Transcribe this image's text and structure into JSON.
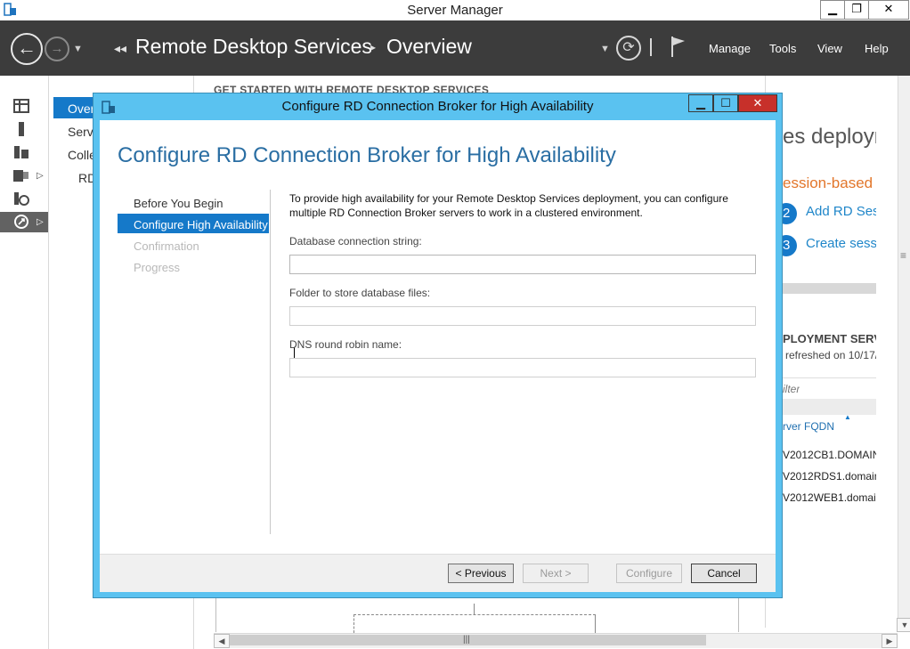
{
  "window": {
    "title": "Server Manager",
    "controls": {
      "minimize": "▁",
      "restore": "❐",
      "close": "✕"
    }
  },
  "header": {
    "breadcrumb": [
      "Remote Desktop Services",
      "Overview"
    ],
    "menu": [
      "Manage",
      "Tools",
      "View",
      "Help"
    ]
  },
  "left_nav": {
    "items": [
      "Overview",
      "Servers",
      "Collections",
      "RD"
    ]
  },
  "background": {
    "heading": "GET STARTED WITH REMOTE DESKTOP SERVICES",
    "right_fragments": {
      "deploy": "es deployn",
      "session": "ession-based",
      "step2_num": "2",
      "step2": "Add RD Ses",
      "step3_num": "3",
      "step3": "Create sess",
      "servers_title": "PLOYMENT SERV",
      "refreshed": "refreshed on 10/17/",
      "filter": "ilter",
      "fqdn_header": "rver FQDN",
      "rows": [
        "V2012CB1.DOMAIN",
        "V2012RDS1.domain",
        "V2012WEB1.domain"
      ]
    }
  },
  "dialog": {
    "title": "Configure RD Connection Broker for High Availability",
    "heading": "Configure RD Connection Broker for High Availability",
    "controls": {
      "minimize": "▁",
      "maximize": "☐",
      "close": "✕"
    },
    "steps": [
      "Before You Begin",
      "Configure High Availability",
      "Confirmation",
      "Progress"
    ],
    "description": "To provide high availability for your Remote Desktop Services deployment, you can configure multiple RD Connection Broker servers to work in a clustered environment.",
    "fields": {
      "db_label": "Database connection string:",
      "db_value": "",
      "folder_label": "Folder to store database files:",
      "folder_value": "",
      "dns_label": "DNS round robin name:",
      "dns_value": ""
    },
    "buttons": {
      "previous": "< Previous",
      "next": "Next >",
      "configure": "Configure",
      "cancel": "Cancel"
    }
  },
  "colors": {
    "accent": "#1579c9",
    "header_bg": "#3c3c3c",
    "dialog_frame": "#5ac2f0",
    "orange": "#e2762b"
  }
}
